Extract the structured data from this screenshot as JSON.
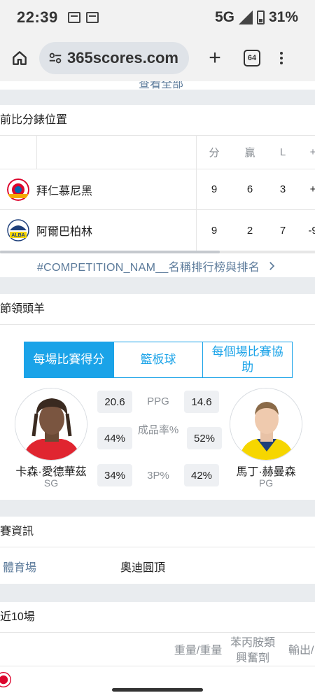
{
  "status_bar": {
    "time": "22:39",
    "network": "5G",
    "battery": "31%"
  },
  "browser": {
    "url": "365scores.com",
    "tab_count": "64"
  },
  "partial_link_top": "查看全部",
  "standings": {
    "title": "前比分錶位置",
    "columns": [
      "分",
      "贏",
      "L",
      "+"
    ],
    "rows": [
      {
        "team": "拜仁慕尼黑",
        "values": [
          "9",
          "6",
          "3",
          "+"
        ]
      },
      {
        "team": "阿爾巴柏林",
        "values": [
          "9",
          "2",
          "7",
          "-9"
        ]
      }
    ],
    "link": "#COMPETITION_NAM__名稱排行榜與排名"
  },
  "leaders": {
    "title": "節領頭羊",
    "tabs": [
      "每場比賽得分",
      "籃板球",
      "每個場比賽協助"
    ],
    "active_tab": 0,
    "left_player": {
      "name": "卡森·愛德華茲",
      "position": "SG"
    },
    "right_player": {
      "name": "馬丁·赫曼森",
      "position": "PG"
    },
    "stats": [
      {
        "label": "PPG",
        "left": "20.6",
        "right": "14.6"
      },
      {
        "label": "成品率%",
        "left": "44%",
        "right": "52%"
      },
      {
        "label": "3P%",
        "left": "34%",
        "right": "42%"
      }
    ]
  },
  "match_info": {
    "title": "賽資訊",
    "rows": [
      {
        "key": "體育場",
        "value": "奧迪圓頂"
      }
    ]
  },
  "last10": {
    "title": "近10場",
    "columns": [
      "重量/重量",
      "苯丙胺類興奮劑",
      "輸出/"
    ]
  },
  "colors": {
    "accent": "#1aa3e8",
    "link": "#5b7a9a",
    "muted": "#8a8f95",
    "bayern_red": "#dc052d",
    "alba_blue": "#1e3f7a",
    "alba_yellow": "#f6d600"
  }
}
